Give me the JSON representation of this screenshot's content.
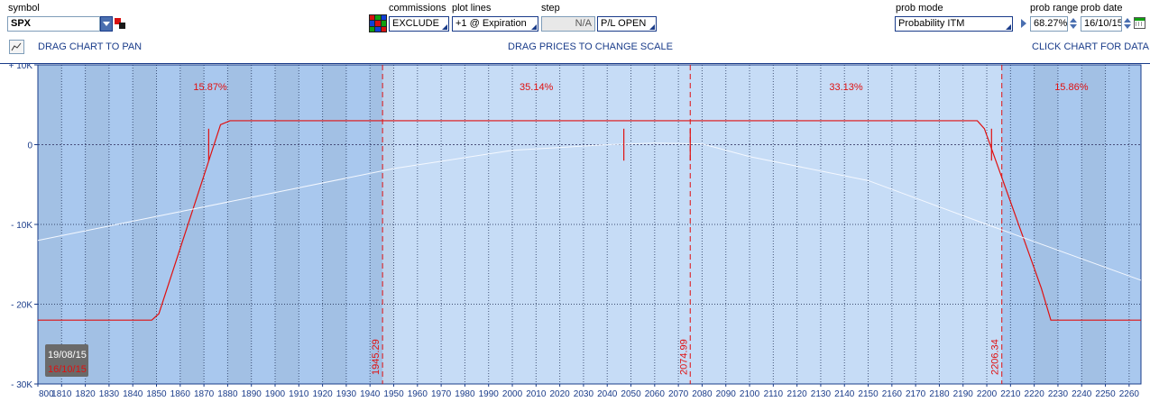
{
  "toolbar": {
    "symbol_label": "symbol",
    "symbol_value": "SPX",
    "commissions_label": "commissions",
    "commissions_value": "EXCLUDE",
    "plot_lines_label": "plot lines",
    "plot_lines_value": "+1 @ Expiration",
    "step_label": "step",
    "step_value": "N/A",
    "pl_mode_value": "P/L OPEN",
    "prob_mode_label": "prob mode",
    "prob_mode_value": "Probability ITM",
    "prob_range_label": "prob range",
    "prob_range_value": "68.27%",
    "prob_date_label": "prob date",
    "prob_date_value": "16/10/15"
  },
  "hints": {
    "pan": "DRAG CHART TO PAN",
    "scale": "DRAG PRICES TO CHANGE SCALE",
    "data": "CLICK CHART FOR DATA"
  },
  "colors": {
    "zone_outer": "#a9c8ee",
    "zone_inner": "#c6dcf6",
    "pl_line": "#e01010",
    "theo_line": "#f4f8ff",
    "axis_text": "#1a3c8a"
  },
  "chart_data": {
    "type": "line",
    "xlim": [
      1800,
      2265
    ],
    "ylim": [
      -30000,
      10000
    ],
    "x_ticks": [
      1800,
      1810,
      1820,
      1830,
      1840,
      1850,
      1860,
      1870,
      1880,
      1890,
      1900,
      1910,
      1920,
      1930,
      1940,
      1950,
      1960,
      1970,
      1980,
      1990,
      2000,
      2010,
      2020,
      2030,
      2040,
      2050,
      2060,
      2070,
      2080,
      2090,
      2100,
      2110,
      2120,
      2130,
      2140,
      2150,
      2160,
      2170,
      2180,
      2190,
      2200,
      2210,
      2220,
      2230,
      2240,
      2250,
      2260
    ],
    "x_tick_labels": [
      "800",
      "1810",
      "1820",
      "1830",
      "1840",
      "1850",
      "1860",
      "1870",
      "1880",
      "1890",
      "1900",
      "1910",
      "1920",
      "1930",
      "1940",
      "1950",
      "1960",
      "1970",
      "1980",
      "1990",
      "2000",
      "2010",
      "2020",
      "2030",
      "2040",
      "2050",
      "2060",
      "2070",
      "2080",
      "2090",
      "2100",
      "2110",
      "2120",
      "2130",
      "2140",
      "2150",
      "2160",
      "2170",
      "2180",
      "2190",
      "2200",
      "2210",
      "2220",
      "2230",
      "2240",
      "2250",
      "2260"
    ],
    "y_ticks": [
      {
        "value": 10000,
        "label": "+ 10K"
      },
      {
        "value": 0,
        "label": "0"
      },
      {
        "value": -10000,
        "label": "- 10K"
      },
      {
        "value": -20000,
        "label": "- 20K"
      },
      {
        "value": -30000,
        "label": "- 30K"
      }
    ],
    "probability_zones": [
      {
        "from": 1800,
        "to": 1945.29,
        "label": "15.87%"
      },
      {
        "from": 1945.29,
        "to": 2074.99,
        "label": "35.14%"
      },
      {
        "from": 2074.99,
        "to": 2206.34,
        "label": "33.13%"
      },
      {
        "from": 2206.34,
        "to": 2265,
        "label": "15.86%"
      }
    ],
    "price_markers": [
      {
        "x": 1945.29,
        "label": "1945.29"
      },
      {
        "x": 2074.99,
        "label": "2074.99"
      },
      {
        "x": 2206.34,
        "label": "2206.34"
      }
    ],
    "strike_marks": [
      1872,
      2047,
      2075,
      2202
    ],
    "series": [
      {
        "kind": "expiration",
        "x": [
          1800,
          1848,
          1851,
          1877,
          1881,
          2196,
          2199,
          2223,
          2227,
          2265
        ],
        "y": [
          -22000,
          -22000,
          -21200,
          2500,
          3000,
          3000,
          2000,
          -18000,
          -22000,
          -22000
        ]
      },
      {
        "kind": "theoretical",
        "x": [
          1800,
          1850,
          1900,
          1950,
          2000,
          2040,
          2060,
          2080,
          2100,
          2150,
          2200,
          2265
        ],
        "y": [
          -12000,
          -9000,
          -6000,
          -3000,
          -700,
          0,
          200,
          100,
          -1500,
          -4500,
          -10000,
          -17000
        ]
      }
    ],
    "dates": [
      "19/08/15",
      "16/10/15"
    ]
  }
}
